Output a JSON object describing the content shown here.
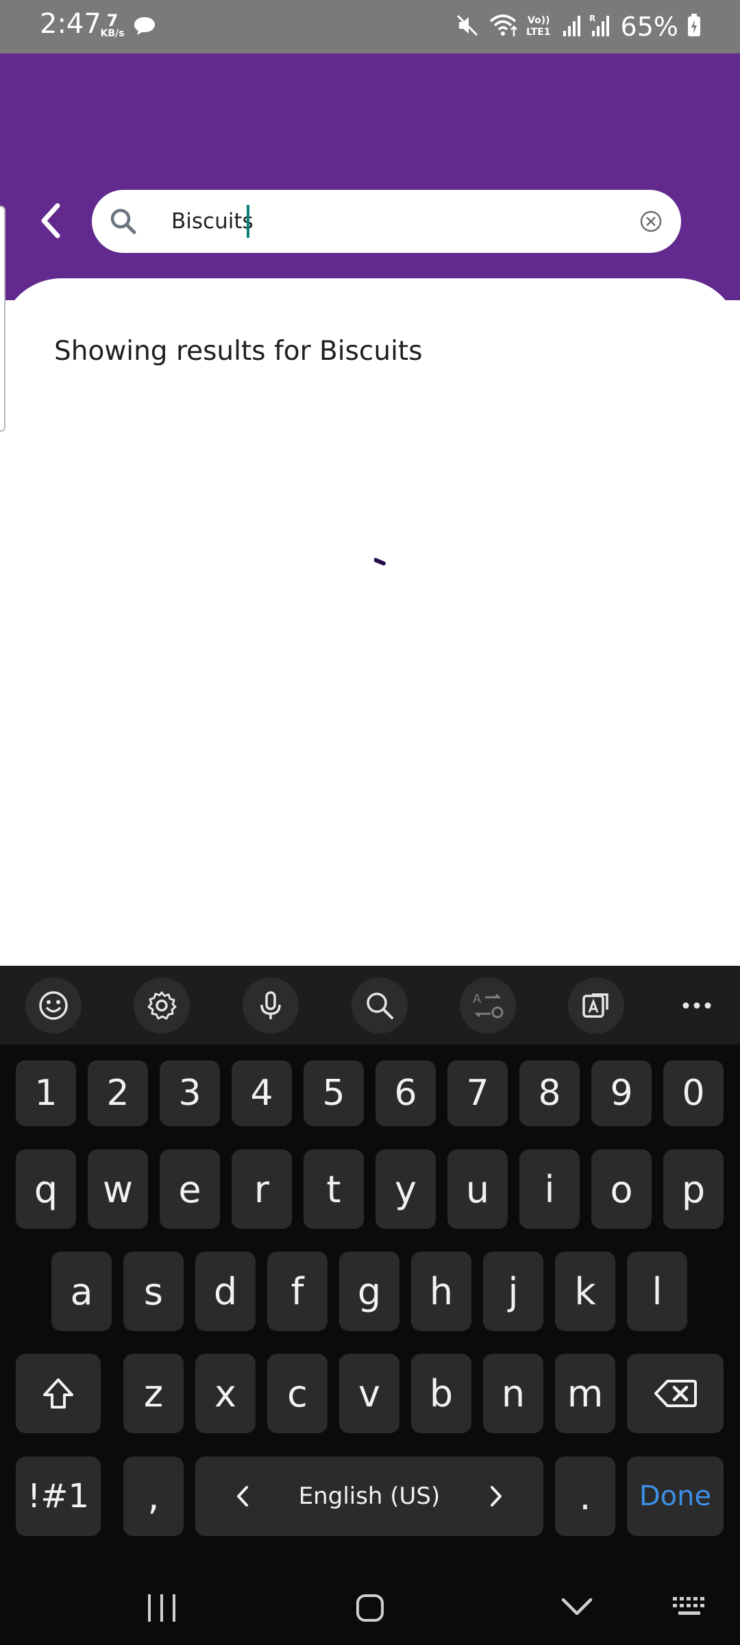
{
  "status_bar": {
    "time": "2:47",
    "speed_value": "7",
    "speed_unit": "KB/s",
    "battery_percent": "65%",
    "icons": [
      "chat-icon",
      "mute-icon",
      "wifi-icon",
      "volte-icon",
      "signal-icon",
      "signal-roaming-icon",
      "battery-charging-icon"
    ]
  },
  "header": {
    "background_color": "#62298e",
    "search": {
      "value": "Biscuits"
    }
  },
  "content": {
    "results_text": "Showing results for Biscuits"
  },
  "keyboard": {
    "toolbar": [
      "emoji-icon",
      "settings-icon",
      "mic-icon",
      "search-icon",
      "translate-icon",
      "image-translate-icon",
      "more-icon"
    ],
    "number_row": [
      "1",
      "2",
      "3",
      "4",
      "5",
      "6",
      "7",
      "8",
      "9",
      "0"
    ],
    "row1": [
      "q",
      "w",
      "e",
      "r",
      "t",
      "y",
      "u",
      "i",
      "o",
      "p"
    ],
    "row2": [
      "a",
      "s",
      "d",
      "f",
      "g",
      "h",
      "j",
      "k",
      "l"
    ],
    "row3": [
      "z",
      "x",
      "c",
      "v",
      "b",
      "n",
      "m"
    ],
    "symbols_label": "!#1",
    "comma_label": ",",
    "space_label": "English (US)",
    "period_label": ".",
    "done_label": "Done"
  },
  "nav_bar": {
    "buttons": [
      "recents-icon",
      "home-icon",
      "back-down-icon",
      "keyboard-toggle-icon"
    ]
  }
}
